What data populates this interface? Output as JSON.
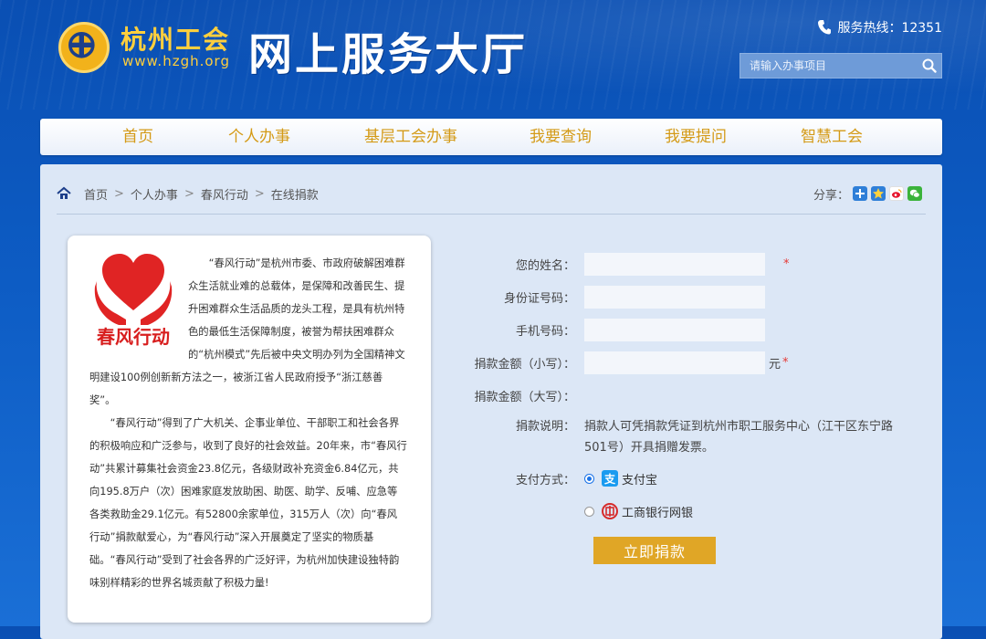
{
  "header": {
    "logo_cn": "杭州工会",
    "logo_url": "www.hzgh.org",
    "site_title": "网上服务大厅",
    "hotline": "服务热线：12351",
    "search_placeholder": "请输入办事项目"
  },
  "nav": {
    "items": [
      "首页",
      "个人办事",
      "基层工会办事",
      "我要查询",
      "我要提问",
      "智慧工会"
    ]
  },
  "breadcrumb": {
    "items": [
      "首页",
      "个人办事",
      "春风行动",
      "在线捐款"
    ],
    "separator": ">"
  },
  "share": {
    "label": "分享："
  },
  "intro": {
    "logo_text": "春风行动",
    "paragraphs": [
      "“春风行动”是杭州市委、市政府破解困难群众生活就业难的总载体，是保障和改善民生、提升困难群众生活品质的龙头工程，是具有杭州特色的最低生活保障制度，被誉为帮扶困难群众的“杭州模式”先后被中央文明办列为全国精神文明建设100例创新新方法之一，被浙江省人民政府授予“浙江慈善奖”。",
      "“春风行动”得到了广大机关、企事业单位、干部职工和社会各界的积极响应和广泛参与，收到了良好的社会效益。20年来，市“春风行动”共累计募集社会资金23.8亿元，各级财政补充资金6.84亿元，共向195.8万户（次）困难家庭发放助困、助医、助学、反哺、应急等各类救助金29.1亿元。有52800余家单位，315万人（次）向“春风行动”捐款献爱心，为“春风行动”深入开展奠定了坚实的物质基础。“春风行动”受到了社会各界的广泛好评，为杭州加快建设独特韵味别样精彩的世界名城贡献了积极力量!"
    ]
  },
  "form": {
    "name_label": "您的姓名：",
    "id_label": "身份证号码：",
    "phone_label": "手机号码：",
    "amount_small_label": "捐款金额（小写）：",
    "amount_unit": "元",
    "amount_big_label": "捐款金额（大写）：",
    "required_mark": "*",
    "note_label": "捐款说明：",
    "note_text": "捐款人可凭捐款凭证到杭州市职工服务中心（江干区东宁路501号）开具捐赠发票。",
    "pay_label": "支付方式：",
    "pay_options": [
      "支付宝",
      "工商银行网银"
    ],
    "pay_selected": "支付宝",
    "submit_label": "立即捐款"
  },
  "colors": {
    "header_bg": "#0a4fb3",
    "nav_text": "#d49a16",
    "panel_bg": "#dce7f6",
    "button_bg": "#e0a626",
    "required": "#e53935",
    "alipay": "#1a9bf0",
    "icbc": "#d62b2b"
  },
  "icons": [
    "phone-icon",
    "search-icon",
    "home-icon",
    "share-plus-icon",
    "qzone-icon",
    "weibo-icon",
    "wechat-icon",
    "alipay-icon",
    "icbc-icon",
    "heart-hands-logo"
  ]
}
